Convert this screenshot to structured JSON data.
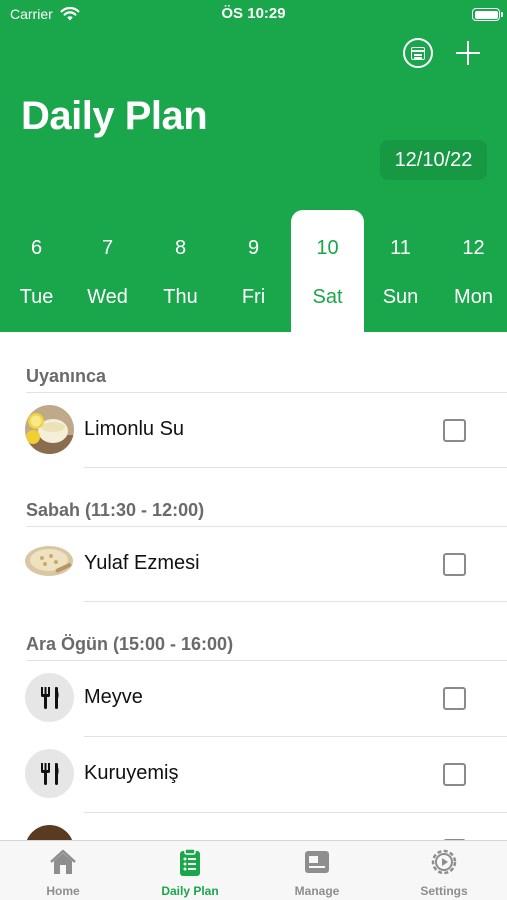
{
  "status_bar": {
    "carrier": "Carrier",
    "time": "ÖS 10:29"
  },
  "header": {
    "title": "Daily Plan",
    "date": "12/10/22",
    "calendar_icon": "calendar-icon",
    "add_icon": "plus-icon"
  },
  "week": [
    {
      "number": "6",
      "name": "Tue",
      "selected": false
    },
    {
      "number": "7",
      "name": "Wed",
      "selected": false
    },
    {
      "number": "8",
      "name": "Thu",
      "selected": false
    },
    {
      "number": "9",
      "name": "Fri",
      "selected": false
    },
    {
      "number": "10",
      "name": "Sat",
      "selected": true
    },
    {
      "number": "11",
      "name": "Sun",
      "selected": false
    },
    {
      "number": "12",
      "name": "Mon",
      "selected": false
    }
  ],
  "sections": [
    {
      "title": "Uyanınca",
      "items": [
        {
          "label": "Limonlu Su",
          "thumb": "lemon-water-photo",
          "checked": false
        }
      ]
    },
    {
      "title": "Sabah (11:30 - 12:00)",
      "items": [
        {
          "label": "Yulaf Ezmesi",
          "thumb": "oatmeal-photo",
          "checked": false
        }
      ]
    },
    {
      "title": "Ara Ögün (15:00 - 16:00)",
      "items": [
        {
          "label": "Meyve",
          "thumb": "fork-knife-icon",
          "checked": false
        },
        {
          "label": "Kuruyemiş",
          "thumb": "fork-knife-icon",
          "checked": false
        }
      ]
    }
  ],
  "tab_bar": {
    "tabs": [
      {
        "label": "Home",
        "icon": "home-icon",
        "active": false
      },
      {
        "label": "Daily Plan",
        "icon": "clipboard-list-icon",
        "active": true
      },
      {
        "label": "Manage",
        "icon": "id-card-icon",
        "active": false
      },
      {
        "label": "Settings",
        "icon": "gear-icon",
        "active": false
      }
    ]
  },
  "colors": {
    "brand_green": "#1aa64a",
    "inactive_gray": "#8e8e8e",
    "section_gray": "#6a6a6a"
  }
}
